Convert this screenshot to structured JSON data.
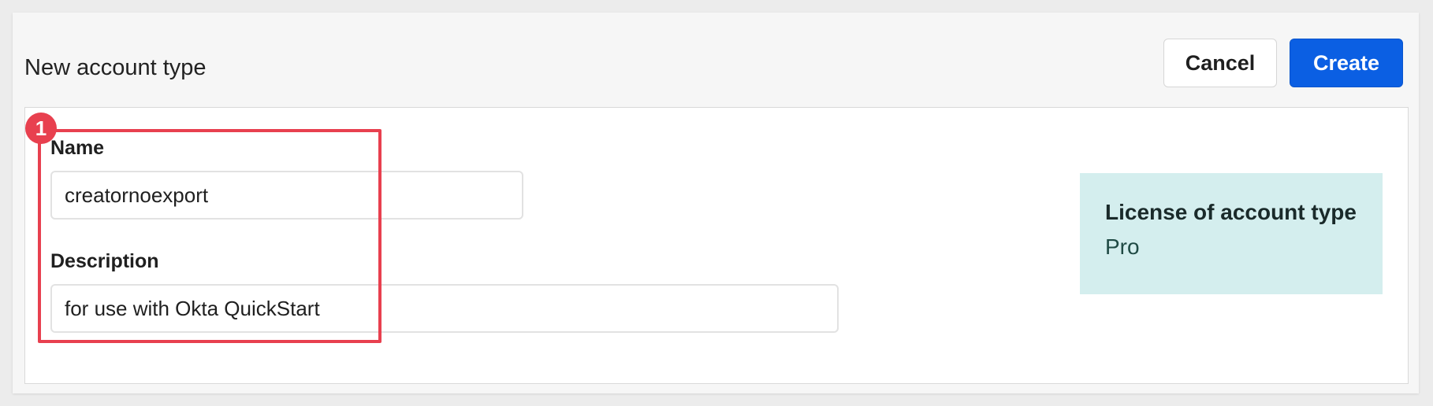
{
  "header": {
    "title": "New account type",
    "cancel_label": "Cancel",
    "create_label": "Create"
  },
  "form": {
    "name_label": "Name",
    "name_value": "creatornoexport",
    "description_label": "Description",
    "description_value": "for use with Okta QuickStart"
  },
  "annotation": {
    "badge_number": "1"
  },
  "license": {
    "title": "License of account type",
    "value": "Pro"
  },
  "colors": {
    "accent": "#0b5fe3",
    "highlight": "#e8404f",
    "license_bg": "#d4eeee"
  }
}
